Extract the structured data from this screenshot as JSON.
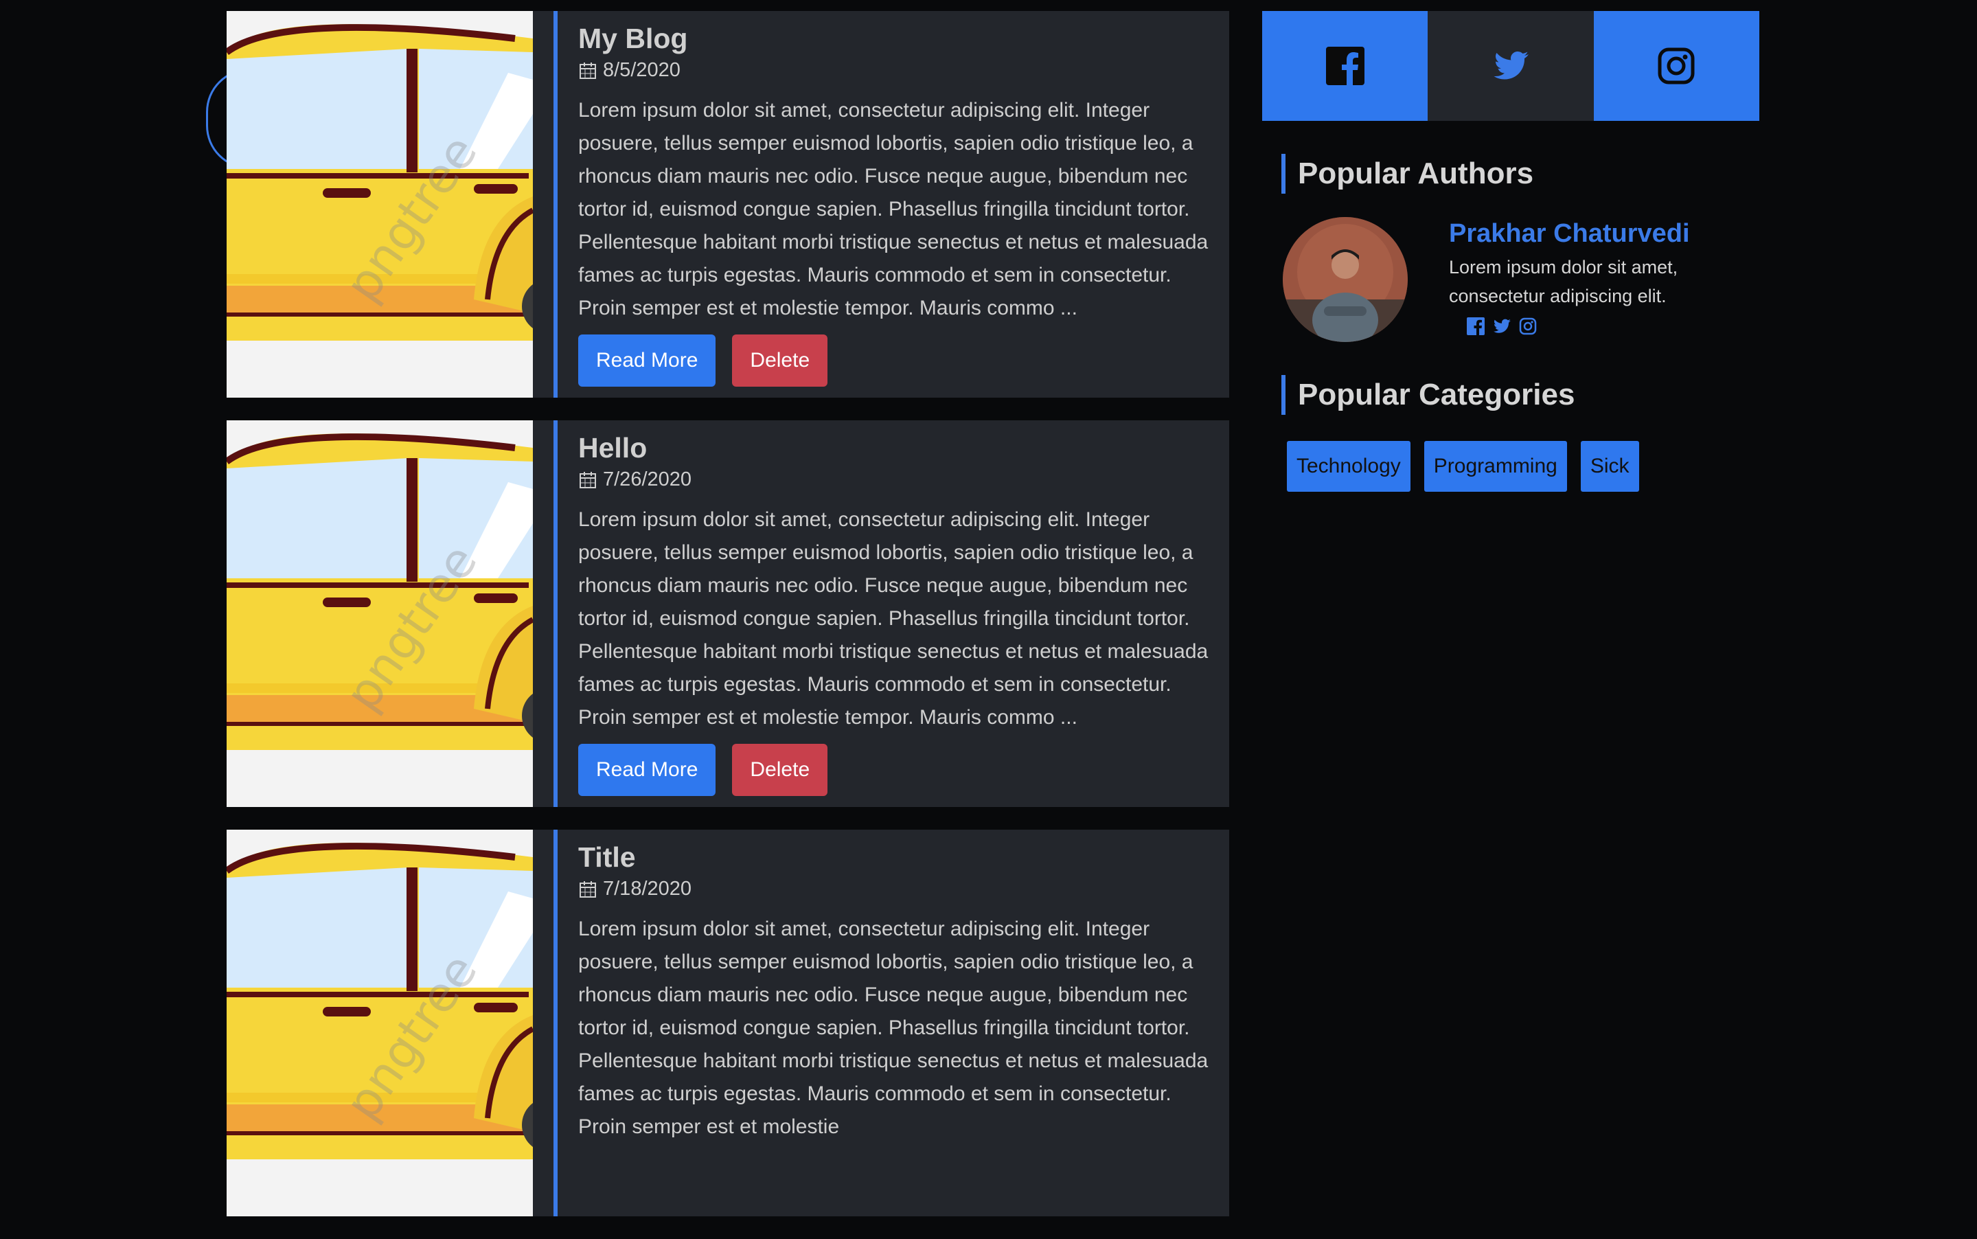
{
  "posts": [
    {
      "title": "My Blog",
      "date": "8/5/2020",
      "excerpt": "Lorem ipsum dolor sit amet, consectetur adipiscing elit. Integer posuere, tellus semper euismod lobortis, sapien odio tristique leo, a rhoncus diam mauris nec odio. Fusce neque augue, bibendum nec tortor id, euismod congue sapien. Phasellus fringilla tincidunt tortor. Pellentesque habitant morbi tristique senectus et netus et malesuada fames ac turpis egestas. Mauris commodo et sem in consectetur. Proin semper est et molestie tempor. Mauris commo ...",
      "read_more": "Read More",
      "delete": "Delete"
    },
    {
      "title": "Hello",
      "date": "7/26/2020",
      "excerpt": "Lorem ipsum dolor sit amet, consectetur adipiscing elit. Integer posuere, tellus semper euismod lobortis, sapien odio tristique leo, a rhoncus diam mauris nec odio. Fusce neque augue, bibendum nec tortor id, euismod congue sapien. Phasellus fringilla tincidunt tortor. Pellentesque habitant morbi tristique senectus et netus et malesuada fames ac turpis egestas. Mauris commodo et sem in consectetur. Proin semper est et molestie tempor. Mauris commo ...",
      "read_more": "Read More",
      "delete": "Delete"
    },
    {
      "title": "Title",
      "date": "7/18/2020",
      "excerpt": "Lorem ipsum dolor sit amet, consectetur adipiscing elit. Integer posuere, tellus semper euismod lobortis, sapien odio tristique leo, a rhoncus diam mauris nec odio. Fusce neque augue, bibendum nec tortor id, euismod congue sapien. Phasellus fringilla tincidunt tortor. Pellentesque habitant morbi tristique senectus et netus et malesuada fames ac turpis egestas. Mauris commodo et sem in consectetur. Proin semper est et molestie",
      "read_more": "Read More",
      "delete": "Delete"
    }
  ],
  "thumbnail_watermark": "pngtree",
  "social": {
    "icons": [
      "facebook-icon",
      "twitter-icon",
      "instagram-icon"
    ]
  },
  "popular_authors": {
    "heading": "Popular Authors",
    "author": {
      "name": "Prakhar Chaturvedi",
      "bio": "Lorem ipsum dolor sit amet, consectetur adipiscing elit."
    }
  },
  "popular_categories": {
    "heading": "Popular Categories",
    "items": [
      "Technology",
      "Programming",
      "Sick"
    ]
  },
  "colors": {
    "accent": "#2f78ee",
    "danger": "#c8404c",
    "background": "#08090b",
    "card": "#23262c"
  }
}
